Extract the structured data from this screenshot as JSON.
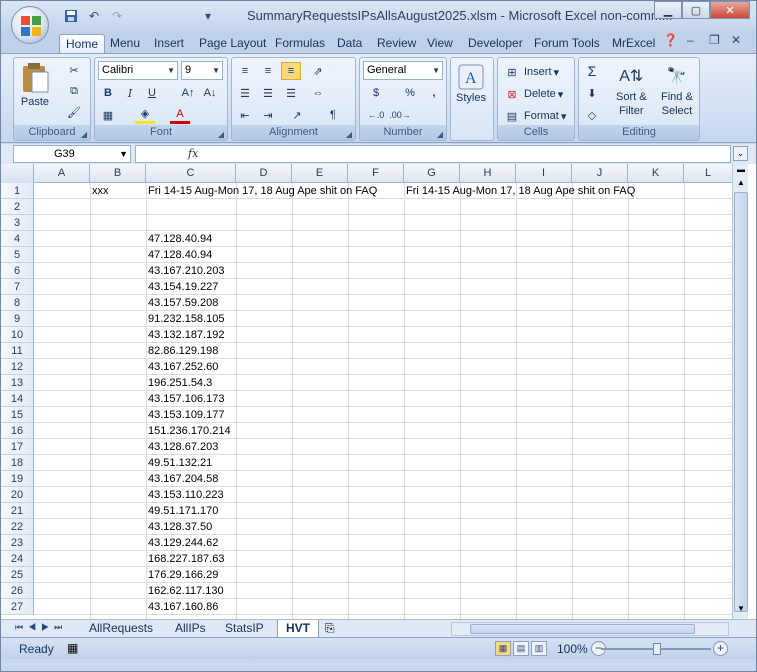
{
  "window": {
    "title": "SummaryRequestsIPsAllsAugust2025.xlsm - Microsoft Excel non-comm..."
  },
  "menu": {
    "tabs": [
      "Home",
      "Menu",
      "Insert",
      "Page Layout",
      "Formulas",
      "Data",
      "Review",
      "View",
      "Developer",
      "Forum Tools",
      "MrExcel"
    ],
    "active": "Home"
  },
  "ribbon": {
    "clipboard": {
      "label": "Clipboard",
      "paste": "Paste"
    },
    "font": {
      "label": "Font",
      "name": "Calibri",
      "size": "9"
    },
    "alignment": {
      "label": "Alignment"
    },
    "number": {
      "label": "Number",
      "format": "General",
      "currency": "$",
      "percent": "%",
      "comma": ","
    },
    "styles": {
      "label": "Styles"
    },
    "cells": {
      "label": "Cells",
      "insert": "Insert",
      "delete": "Delete",
      "format": "Format"
    },
    "editing": {
      "label": "Editing",
      "sort": "Sort &",
      "filter": "Filter",
      "find": "Find &",
      "select": "Select"
    }
  },
  "formula_bar": {
    "name_box": "G39",
    "fx": "fx",
    "content": ""
  },
  "columns": [
    "A",
    "B",
    "C",
    "D",
    "E",
    "F",
    "G",
    "H",
    "I",
    "J",
    "K",
    "L"
  ],
  "rows": [
    {
      "n": "1",
      "b": "xxx",
      "c": "Fri 14-15 Aug-Mon 17, 18 Aug Ape shit on FAQ",
      "g": "Fri 14-15 Aug-Mon 17, 18 Aug Ape shit on FAQ"
    },
    {
      "n": "2",
      "b": "",
      "c": "",
      "g": ""
    },
    {
      "n": "3",
      "b": "",
      "c": "",
      "g": ""
    },
    {
      "n": "4",
      "b": "",
      "c": "47.128.40.94",
      "g": ""
    },
    {
      "n": "5",
      "b": "",
      "c": "47.128.40.94",
      "g": ""
    },
    {
      "n": "6",
      "b": "",
      "c": "43.167.210.203",
      "g": ""
    },
    {
      "n": "7",
      "b": "",
      "c": "43.154.19.227",
      "g": ""
    },
    {
      "n": "8",
      "b": "",
      "c": "43.157.59.208",
      "g": ""
    },
    {
      "n": "9",
      "b": "",
      "c": "91.232.158.105",
      "g": ""
    },
    {
      "n": "10",
      "b": "",
      "c": "43.132.187.192",
      "g": ""
    },
    {
      "n": "11",
      "b": "",
      "c": "82.86.129.198",
      "g": ""
    },
    {
      "n": "12",
      "b": "",
      "c": "43.167.252.60",
      "g": ""
    },
    {
      "n": "13",
      "b": "",
      "c": "196.251.54.3",
      "g": ""
    },
    {
      "n": "14",
      "b": "",
      "c": "43.157.106.173",
      "g": ""
    },
    {
      "n": "15",
      "b": "",
      "c": "43.153.109.177",
      "g": ""
    },
    {
      "n": "16",
      "b": "",
      "c": "151.236.170.214",
      "g": ""
    },
    {
      "n": "17",
      "b": "",
      "c": "43.128.67.203",
      "g": ""
    },
    {
      "n": "18",
      "b": "",
      "c": "49.51.132.21",
      "g": ""
    },
    {
      "n": "19",
      "b": "",
      "c": "43.167.204.58",
      "g": ""
    },
    {
      "n": "20",
      "b": "",
      "c": "43.153.110.223",
      "g": ""
    },
    {
      "n": "21",
      "b": "",
      "c": "49.51.171.170",
      "g": ""
    },
    {
      "n": "22",
      "b": "",
      "c": "43.128.37.50",
      "g": ""
    },
    {
      "n": "23",
      "b": "",
      "c": "43.129.244.62",
      "g": ""
    },
    {
      "n": "24",
      "b": "",
      "c": "168.227.187.63",
      "g": ""
    },
    {
      "n": "25",
      "b": "",
      "c": "176.29.166.29",
      "g": ""
    },
    {
      "n": "26",
      "b": "",
      "c": "162.62.117.130",
      "g": ""
    },
    {
      "n": "27",
      "b": "",
      "c": "43.167.160.86",
      "g": ""
    }
  ],
  "sheets": [
    "AllRequests",
    "AllIPs",
    "StatsIP",
    "HVT"
  ],
  "active_sheet": "HVT",
  "status": {
    "text": "Ready",
    "zoom": "100%"
  },
  "colors": {
    "accent": "#c4d5ec",
    "grid": "#dadcdd",
    "header": "#dde6f2"
  }
}
